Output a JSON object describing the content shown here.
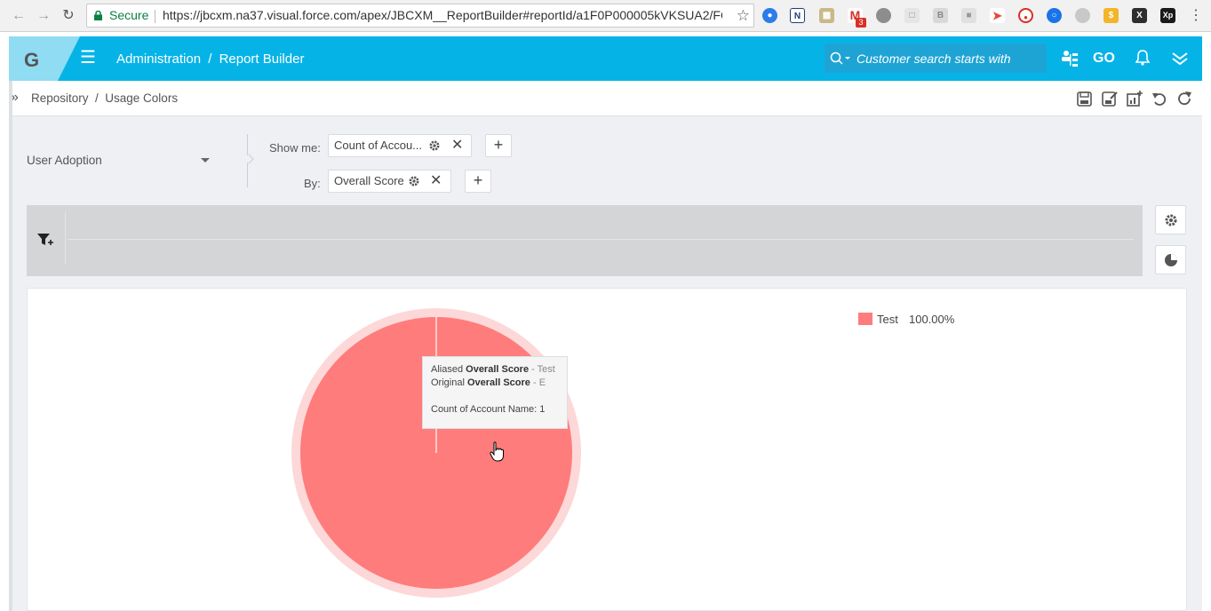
{
  "browser": {
    "secure_label": "Secure",
    "url": "https://jbcxm.na37.visual.force.com/apex/JBCXM__ReportBuilder#reportId/a1F0P000005kVKSUA2/FO...",
    "gmail_badge": "3"
  },
  "header": {
    "logo": "G",
    "breadcrumb_section": "Administration",
    "breadcrumb_sep": "/",
    "breadcrumb_page": "Report Builder",
    "search_placeholder": "Customer search starts with",
    "go_label": "GO"
  },
  "subbar": {
    "breadcrumb": "Repository  /  Usage Colors"
  },
  "builder": {
    "data_source": "User Adoption",
    "show_me_label": "Show me:",
    "show_me_chip": "Count of Accou...",
    "by_label": "By:",
    "by_chip": "Overall Score",
    "add_symbol": "+"
  },
  "tooltip": {
    "aliased_prefix": "Aliased",
    "aliased_field": "Overall Score",
    "aliased_value": "- Test",
    "original_prefix": "Original",
    "original_field": "Overall Score",
    "original_value": "- E",
    "metric": "Count of Account Name: 1"
  },
  "colors": {
    "header_bg": "#06b3e7",
    "slice": "#ff7c7c",
    "halo": "#fdd8d8"
  },
  "chart_data": {
    "type": "pie",
    "title": "",
    "slices": [
      {
        "label": "Test",
        "value": 100.0,
        "display": "100.00%",
        "color": "#ff7c7c"
      }
    ],
    "legend_position": "top-right"
  }
}
